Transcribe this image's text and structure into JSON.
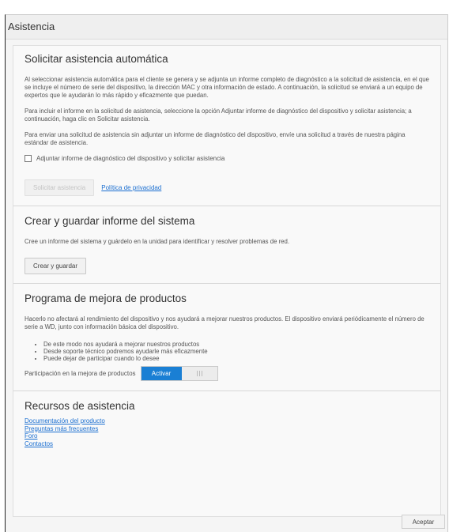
{
  "window": {
    "title": "Asistencia"
  },
  "auto": {
    "heading": "Solicitar asistencia automática",
    "p1": "Al seleccionar asistencia automática para el cliente se genera y se adjunta un informe completo de diagnóstico a la solicitud de asistencia, en el que se incluye el número de serie del dispositivo, la dirección MAC y otra información de estado. A continuación, la solicitud se enviará a un equipo de expertos que le ayudarán lo más rápido y eficazmente que puedan.",
    "p2": "Para incluir el informe en la solicitud de asistencia, seleccione la opción Adjuntar informe de diagnóstico del dispositivo y solicitar asistencia; a continuación, haga clic en Solicitar asistencia.",
    "p3": "Para enviar una solicitud de asistencia sin adjuntar un informe de diagnóstico del dispositivo, envíe una solicitud a través de nuestra página estándar de asistencia.",
    "checkbox_label": "Adjuntar informe de diagnóstico del dispositivo y solicitar asistencia",
    "checkbox_checked": false,
    "request_button": "Solicitar asistencia",
    "privacy_link": "Política de privacidad"
  },
  "report": {
    "heading": "Crear y guardar informe del sistema",
    "p1": "Cree un informe del sistema y guárdelo en la unidad para identificar y resolver problemas de red.",
    "button": "Crear y guardar"
  },
  "improve": {
    "heading": "Programa de mejora de productos",
    "p1": "Hacerlo no afectará al rendimiento del dispositivo y nos ayudará a mejorar nuestros productos. El dispositivo enviará periódicamente el número de serie a WD, junto con información básica del dispositivo.",
    "bullets": [
      "De este modo nos ayudará a mejorar nuestros productos",
      "Desde soporte técnico podremos ayudarle más eficazmente",
      "Puede dejar de participar cuando lo desee"
    ],
    "participation_label": "Participación en la mejora de productos",
    "toggle_on_label": "Activar",
    "toggle_state": "on",
    "accent_color": "#1a7fd4"
  },
  "resources": {
    "heading": "Recursos de asistencia",
    "links": [
      "Documentación del producto",
      "Preguntas más frecuentes",
      "Foro",
      "Contactos"
    ]
  },
  "footer": {
    "accept_button": "Aceptar"
  }
}
